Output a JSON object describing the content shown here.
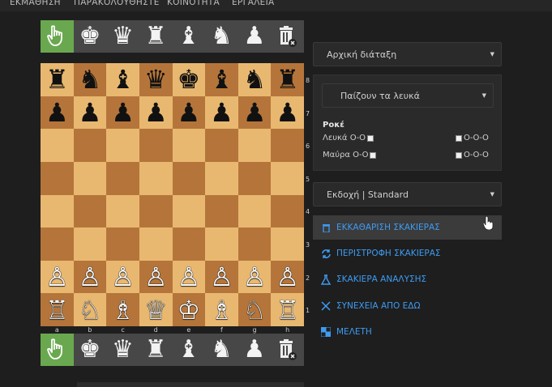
{
  "topnav": [
    "ΕΚΜΑΘΗΣΗ",
    "ΠΑΡΑΚΟΛΟΥΘΗΣΤΕ",
    "ΚΟΙΝΟΤΗΤΑ",
    "ΕΡΓΑΛΕΙΑ"
  ],
  "toolbar_pieces": [
    "♚",
    "♛",
    "♜",
    "♝",
    "♞",
    "♟"
  ],
  "board": [
    [
      "♜",
      "♞",
      "♝",
      "♛",
      "♚",
      "♝",
      "♞",
      "♜"
    ],
    [
      "♟",
      "♟",
      "♟",
      "♟",
      "♟",
      "♟",
      "♟",
      "♟"
    ],
    [
      "",
      "",
      "",
      "",
      "",
      "",
      "",
      ""
    ],
    [
      "",
      "",
      "",
      "",
      "",
      "",
      "",
      ""
    ],
    [
      "",
      "",
      "",
      "",
      "",
      "",
      "",
      ""
    ],
    [
      "",
      "",
      "",
      "",
      "",
      "",
      "",
      ""
    ],
    [
      "♙",
      "♙",
      "♙",
      "♙",
      "♙",
      "♙",
      "♙",
      "♙"
    ],
    [
      "♖",
      "♘",
      "♗",
      "♕",
      "♔",
      "♗",
      "♘",
      "♖"
    ]
  ],
  "ranks": [
    "8",
    "7",
    "6",
    "5",
    "4",
    "3",
    "2",
    "1"
  ],
  "files": [
    "a",
    "b",
    "c",
    "d",
    "e",
    "f",
    "g",
    "h"
  ],
  "setup_select": "Αρχική διάταξη",
  "turn_select": "Παίζουν τα λευκά",
  "castling": {
    "title": "Ροκέ",
    "white_label": "Λευκά Ο-Ο",
    "black_label": "Μαύρα Ο-Ο",
    "long_label": "Ο-Ο-Ο"
  },
  "variant_select": "Εκδοχή | Standard",
  "actions": [
    {
      "label": "ΕΚΚΑΘΑΡΙΣΗ ΣΚΑΚΙΕΡΑΣ",
      "icon": "trash-icon"
    },
    {
      "label": "ΠΕΡΙΣΤΡΟΦΗ ΣΚΑΚΙΕΡΑΣ",
      "icon": "rotate-icon"
    },
    {
      "label": "ΣΚΑΚΙΕΡΑ ΑΝΑΛΥΣΗΣ",
      "icon": "flask-icon"
    },
    {
      "label": "ΣΥΝΕΧΕΙΑ ΑΠΟ ΕΔΩ",
      "icon": "swords-icon"
    },
    {
      "label": "ΜΕΛΕΤΗ",
      "icon": "study-icon"
    }
  ],
  "colors": {
    "accent": "#3e9bf2",
    "active_tool": "#6aa84f",
    "light_square": "#e9b870",
    "dark_square": "#b5753a"
  }
}
